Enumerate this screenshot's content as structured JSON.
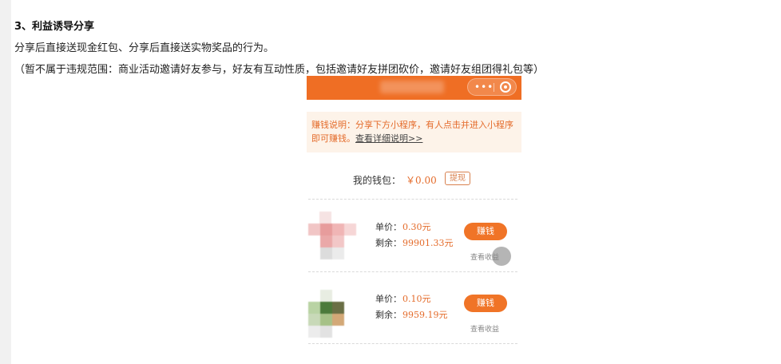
{
  "doc": {
    "heading": "3、利益诱导分享",
    "paragraph1": "分享后直接送现金红包、分享后直接送实物奖品的行为。",
    "paragraph2": "（暂不属于违规范围：商业活动邀请好友参与，好友有互动性质，包括邀请好友拼团砍价，邀请好友组团得礼包等）"
  },
  "phone": {
    "topbar": {
      "accent_color": "#ef6e24",
      "more_icon": "more-dots-icon",
      "close_icon": "target-close-icon"
    },
    "notice": {
      "text": "赚钱说明：分享下方小程序，有人点击并进入小程序即可赚钱。",
      "link": "查看详细说明>>"
    },
    "wallet": {
      "label": "我的钱包：",
      "amount": "￥0.00",
      "withdraw_label": "提现"
    },
    "items": [
      {
        "unit_price_label": "单价：",
        "unit_price": "0.30元",
        "remaining_label": "剩余：",
        "remaining": "99901.33元",
        "earn_label": "赚钱",
        "view_label": "查看收益"
      },
      {
        "unit_price_label": "单价：",
        "unit_price": "0.10元",
        "remaining_label": "剩余：",
        "remaining": "9959.19元",
        "earn_label": "赚钱",
        "view_label": "查看收益"
      }
    ]
  }
}
